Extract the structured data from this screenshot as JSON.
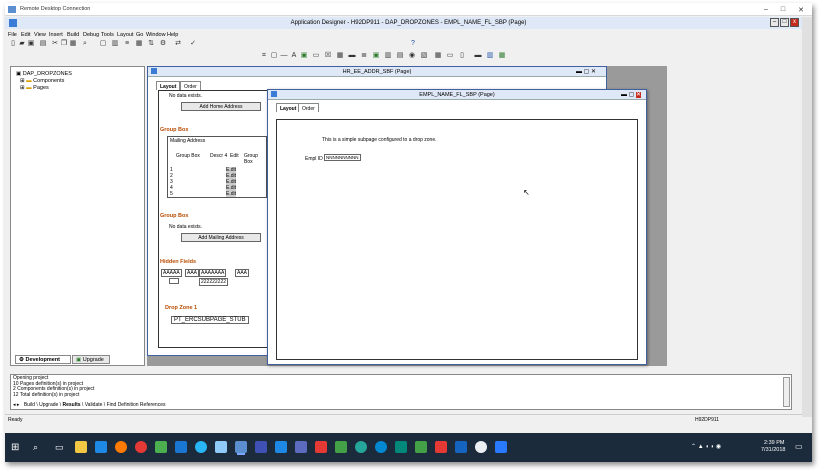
{
  "rdp_title": "Remote Desktop Connection",
  "app_title": "Application Designer - H92DP911 - DAP_DROPZONES - EMPL_NAME_FL_SBP (Page)",
  "menu": [
    "File",
    "Edit",
    "View",
    "Insert",
    "Build",
    "Debug",
    "Tools",
    "Layout",
    "Go",
    "Window",
    "Help"
  ],
  "tree": {
    "root": "DAP_DROPZONES",
    "items": [
      "Components",
      "Pages"
    ]
  },
  "project_tabs": [
    "Development",
    "Upgrade"
  ],
  "addr_window": {
    "title": "HR_EE_ADDR_SBF (Page)",
    "tabs": [
      "Layout",
      "Order"
    ],
    "no_data_1": "No data exists.",
    "add_home_btn": "Add Home Address",
    "group_box_1": "Group Box",
    "mailing_address": "Mailing Address",
    "grid_headers": [
      "Group Box",
      "Descr 4",
      "Edit",
      "Group Box"
    ],
    "grid_rows": [
      "1",
      "2",
      "3",
      "4",
      "5"
    ],
    "grid_cell": "E.dit",
    "group_box_2": "Group Box",
    "no_data_2": "No data exists.",
    "add_mailing_btn": "Add Mailing Address",
    "hidden_fields": "Hidden Fields",
    "hidden_vals": [
      "AAAAA",
      "AAA",
      "AAAAAAA",
      "AAA",
      "",
      "222222222"
    ],
    "drop_zone": "Drop Zone 1",
    "stub": "PT_ERCSUBPAGE_STUB"
  },
  "empl_window": {
    "title": "EMPL_NAME_FL_SBP (Page)",
    "tabs": [
      "Layout",
      "Order"
    ],
    "desc": "This is a simple subpage configured to a drop zone.",
    "field_label": "Empl ID",
    "field_value": "NNNNNNNNNN"
  },
  "output": {
    "lines": [
      "Opening project",
      "10 Pages definition(s) in project",
      "2 Components definition(s) in project",
      "12 Total definition(s) in project"
    ],
    "tabs": [
      "Build",
      "Upgrade",
      "Results",
      "Validate",
      "Find Definition References"
    ]
  },
  "status": {
    "left": "Ready",
    "server": "H92DP911"
  },
  "clock": {
    "time": "2:39 PM",
    "date": "7/31/2018"
  },
  "colors": {
    "taskbar": "#1c2b3c",
    "accent": "#0078d7",
    "groupbox_title": "#b84a00"
  }
}
